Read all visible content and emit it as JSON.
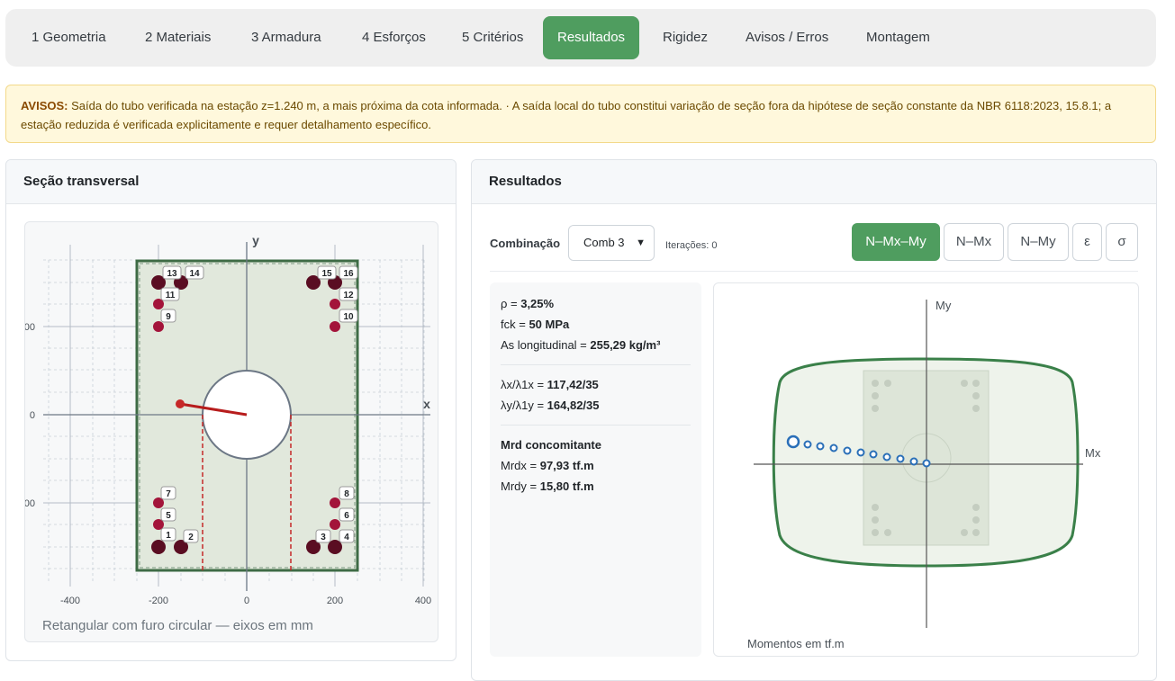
{
  "tabs": [
    {
      "label": "1 Geometria",
      "active": false
    },
    {
      "label": "2 Materiais",
      "active": false
    },
    {
      "label": "3 Armadura",
      "active": false
    },
    {
      "label": "4 Esforços",
      "active": false
    },
    {
      "label": "5 Critérios",
      "active": false
    },
    {
      "label": "Resultados",
      "active": true
    },
    {
      "label": "Rigidez",
      "active": false
    },
    {
      "label": "Avisos / Erros",
      "active": false
    },
    {
      "label": "Montagem",
      "active": false
    }
  ],
  "alert": {
    "title": "AVISOS:",
    "text": "Saída do tubo verificada na estação z=1.240 m, a mais próxima da cota informada. · A saída local do tubo constitui variação de seção fora da hipótese de seção constante da NBR 6118:2023, 15.8.1; a estação reduzida é verificada explicitamente e requer detalhamento específico."
  },
  "section": {
    "title": "Seção transversal",
    "caption": "Retangular com furo circular — eixos em mm",
    "y_axis": "y",
    "x_axis": "x",
    "x_ticks": [
      "-400",
      "-200",
      "0",
      "200",
      "400"
    ],
    "y_ticks": [
      "00",
      "0",
      "00"
    ],
    "bars": [
      "1",
      "2",
      "3",
      "4",
      "5",
      "6",
      "7",
      "8",
      "9",
      "10",
      "11",
      "12",
      "13",
      "14",
      "15",
      "16"
    ]
  },
  "results": {
    "title": "Resultados",
    "combo_label": "Combinação",
    "combo_value": "Comb 3",
    "iterations": "Iterações: 0",
    "view_buttons": [
      {
        "label": "N–Mx–My",
        "active": true
      },
      {
        "label": "N–Mx",
        "active": false
      },
      {
        "label": "N–My",
        "active": false
      },
      {
        "label": "ε",
        "active": false
      },
      {
        "label": "σ",
        "active": false
      }
    ],
    "stats": {
      "rho_label": "ρ = ",
      "rho": "3,25%",
      "fck_label": "fck = ",
      "fck": "50 MPa",
      "as_label": "As longitudinal = ",
      "as": "255,29 kg/m³",
      "lx_label": "λx/λ1x = ",
      "lx": "117,42/35",
      "ly_label": "λy/λ1y = ",
      "ly": "164,82/35",
      "mrd_title": "Mrd concomitante",
      "mrdx_label": "Mrdx = ",
      "mrdx": "97,93 tf.m",
      "mrdy_label": "Mrdy = ",
      "mrdy": "15,80 tf.m"
    },
    "plot": {
      "y_axis": "My",
      "x_axis": "Mx",
      "caption": "Momentos em tf.m"
    }
  },
  "colors": {
    "accent": "#4f9d5f",
    "section_fill": "#e1e8dc",
    "section_border": "#3e6b45",
    "bar_fill": "#7a1030",
    "curve": "#3a8049",
    "path_points": "#2a6fb8"
  }
}
